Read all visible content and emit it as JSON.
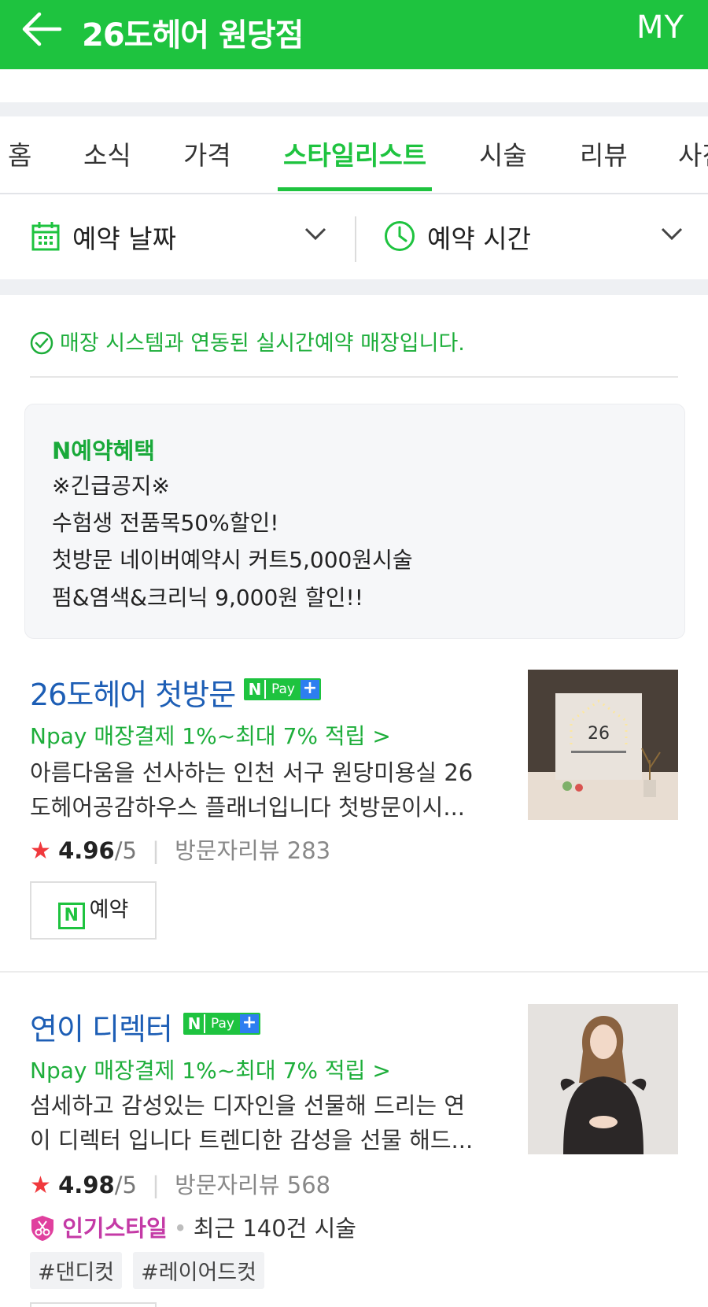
{
  "header": {
    "title": "26도헤어 원당점",
    "my_label": "MY"
  },
  "tabs": [
    "홈",
    "소식",
    "가격",
    "스타일리스트",
    "시술",
    "리뷰",
    "사진"
  ],
  "active_tab": "스타일리스트",
  "filters": {
    "date_label": "예약 날짜",
    "time_label": "예약 시간"
  },
  "realtime_notice": "매장 시스템과 연동된 실시간예약 매장입니다.",
  "benefit": {
    "title": "N예약혜택",
    "lines": [
      "※긴급공지※",
      "수험생 전품목50%할인!",
      "첫방문 네이버예약시 커트5,000원시술",
      "펌&염색&크리닉 9,000원 할인!!"
    ]
  },
  "designers": [
    {
      "name": "26도헤어 첫방문",
      "npay_badge": {
        "n": "N",
        "pay": "Pay",
        "plus": "+"
      },
      "npay_text": "Npay 매장결제 1%~최대 7% 적립 >",
      "desc_line1": "아름다움을 선사하는 인천 서구 원당미용실 26",
      "desc_line2": "도헤어공감하우스 플래너입니다 첫방문이시...",
      "rating": "4.96",
      "rating_max": "/5",
      "review_label": "방문자리뷰 283",
      "reserve_label": "예약"
    },
    {
      "name": "연이 디렉터",
      "npay_badge": {
        "n": "N",
        "pay": "Pay",
        "plus": "+"
      },
      "npay_text": "Npay 매장결제 1%~최대 7% 적립 >",
      "desc_line1": "섬세하고 감성있는 디자인을 선물해 드리는 연",
      "desc_line2": "이 디렉터 입니다 트렌디한 감성을 선물 해드...",
      "rating": "4.98",
      "rating_max": "/5",
      "review_label": "방문자리뷰 568",
      "popular_badge": "인기스타일",
      "popular_text": "최근 140건 시술",
      "tags": [
        "#댄디컷",
        "#레이어드컷"
      ]
    }
  ],
  "colors": {
    "brand_green": "#1ec33f",
    "link_blue": "#1d5eb5",
    "star_red": "#f0393d",
    "popular_pink": "#c43aa6"
  },
  "icons": [
    "back-arrow-icon",
    "calendar-icon",
    "clock-icon",
    "chevron-down-icon",
    "check-circle-icon",
    "star-icon",
    "scissors-shield-icon"
  ]
}
